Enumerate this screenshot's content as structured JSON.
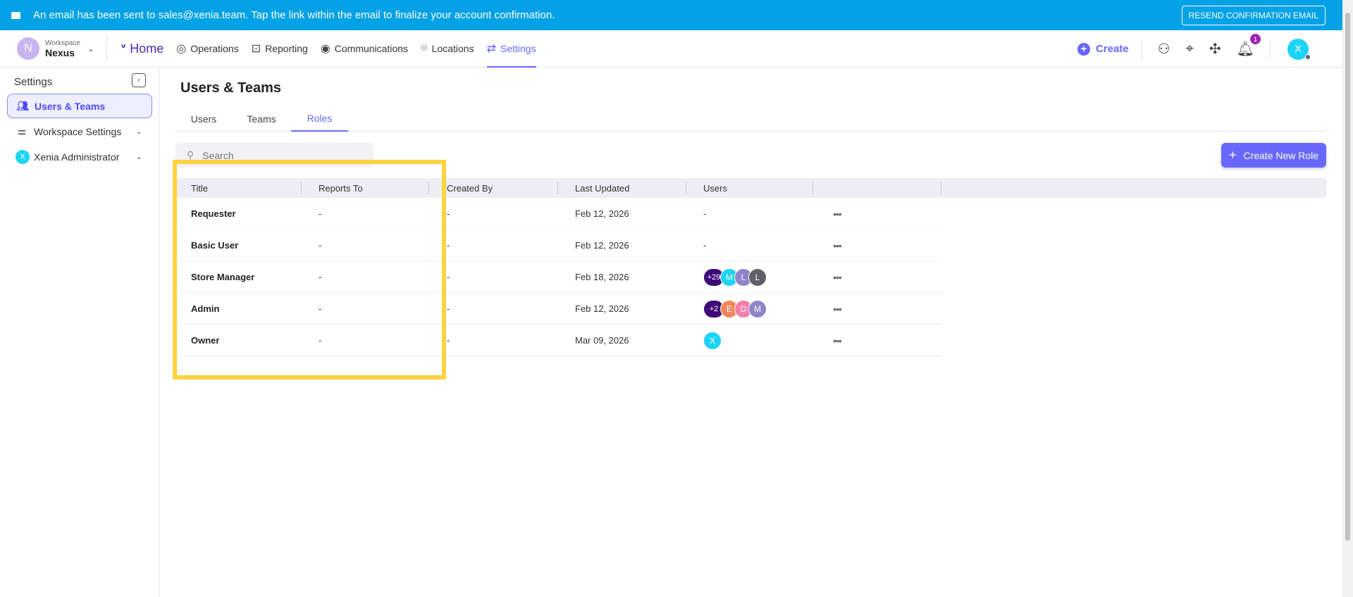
{
  "banner": {
    "message": "An email has been sent to sales@xenia.team. Tap the link within the email to finalize your account confirmation.",
    "button": "RESEND CONFIRMATION EMAIL"
  },
  "workspace": {
    "label": "Workspace",
    "name": "Nexus",
    "initial": "N"
  },
  "nav": {
    "home": "Home",
    "items": [
      "Operations",
      "Reporting",
      "Communications",
      "Locations",
      "Settings"
    ],
    "create": "Create",
    "notifications": "1",
    "user_initial": "X"
  },
  "sidebar": {
    "title": "Settings",
    "items": [
      "Users & Teams",
      "Workspace Settings",
      "Xenia Administrator"
    ],
    "admin_initial": "X"
  },
  "page": {
    "title": "Users & Teams",
    "tabs": [
      "Users",
      "Teams",
      "Roles"
    ],
    "search_placeholder": "Search",
    "create_button": "Create New Role"
  },
  "table": {
    "headers": [
      "Title",
      "Reports To",
      "Created By",
      "Last Updated",
      "Users"
    ],
    "rows": [
      {
        "title": "Requester",
        "reports_to": "-",
        "created_by": "-",
        "updated": "Feb 12, 2026",
        "users_text": "-",
        "avatars": []
      },
      {
        "title": "Basic User",
        "reports_to": "-",
        "created_by": "-",
        "updated": "Feb 12, 2026",
        "users_text": "-",
        "avatars": []
      },
      {
        "title": "Store Manager",
        "reports_to": "-",
        "created_by": "-",
        "updated": "Feb 18, 2026",
        "users_text": "",
        "avatars": [
          {
            "t": "+29",
            "c": "#3D0A7A"
          },
          {
            "t": "M",
            "c": "#1ED3F5"
          },
          {
            "t": "L",
            "c": "#8E85C9"
          },
          {
            "t": "L",
            "c": "#5F6068"
          }
        ]
      },
      {
        "title": "Admin",
        "reports_to": "-",
        "created_by": "-",
        "updated": "Feb 12, 2026",
        "users_text": "",
        "avatars": [
          {
            "t": "+2",
            "c": "#3D0A7A"
          },
          {
            "t": "E",
            "c": "#F0875A"
          },
          {
            "t": "D",
            "c": "#F37FA8"
          },
          {
            "t": "M",
            "c": "#8E85C9"
          }
        ]
      },
      {
        "title": "Owner",
        "reports_to": "-",
        "created_by": "-",
        "updated": "Mar 09, 2026",
        "users_text": "",
        "avatars": [
          {
            "t": "X",
            "c": "#1ED3F5"
          }
        ]
      }
    ],
    "more": "•••"
  }
}
